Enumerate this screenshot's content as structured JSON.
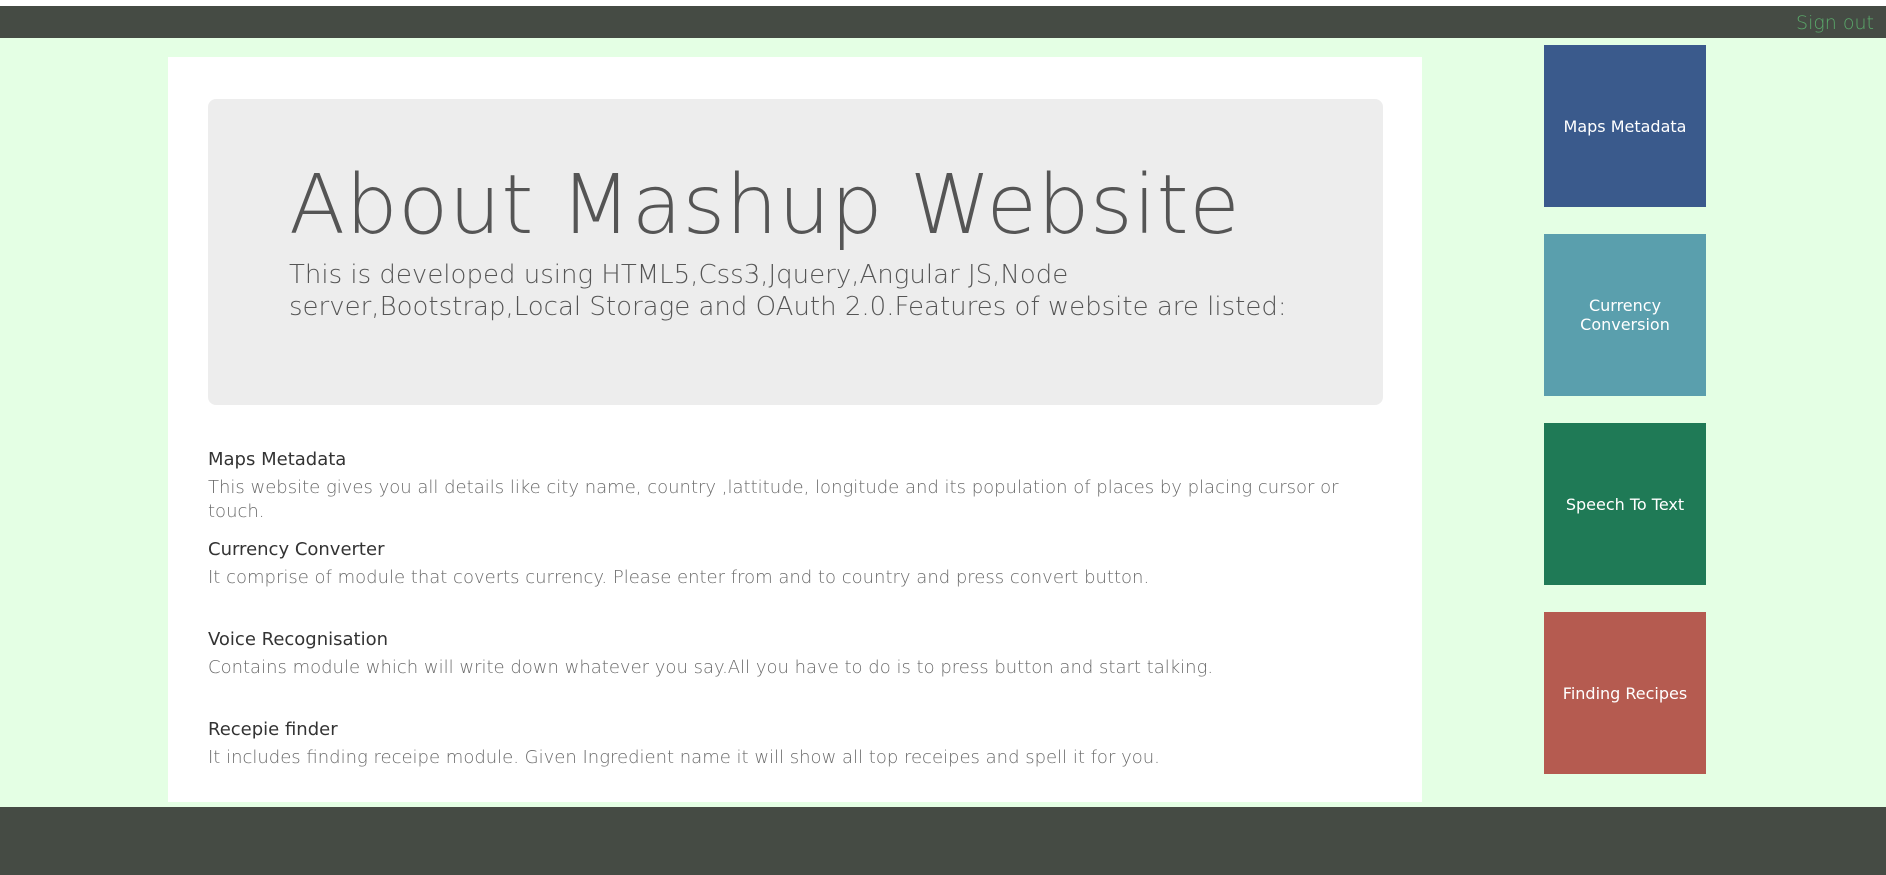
{
  "header": {
    "signout_label": "Sign out"
  },
  "jumbotron": {
    "title": "About Mashup Website",
    "text_line1": "This is developed using HTML5,Css3,Jquery,Angular JS,Node",
    "text_line2": "server,Bootstrap,Local Storage and OAuth 2.0.Features of website are listed:"
  },
  "features": [
    {
      "title": "Maps Metadata",
      "description": "This website gives you all details like city name, country ,lattitude, longitude and its population of places by placing cursor or touch."
    },
    {
      "title": "Currency Converter",
      "description": "It comprise of module that coverts currency. Please enter from and to country and press convert button."
    },
    {
      "title": "Voice Recognisation",
      "description": "Contains module which will write down whatever you say.All you have to do is to press button and start talking."
    },
    {
      "title": "Recepie finder",
      "description": "It includes finding receipe module. Given Ingredient name it will show all top receipes and spell it for you."
    }
  ],
  "tiles": [
    {
      "label": "Maps Metadata",
      "color": "#3a5a8c"
    },
    {
      "label": "Currency Conversion",
      "color": "#5a9fad"
    },
    {
      "label": "Speech To Text",
      "color": "#1f7a56"
    },
    {
      "label": "Finding Recipes",
      "color": "#b55b50"
    }
  ],
  "colors": {
    "background": "#e4ffe4",
    "navbar": "#454b44",
    "signout": "#5aa86a",
    "jumbotron": "#ededed"
  }
}
